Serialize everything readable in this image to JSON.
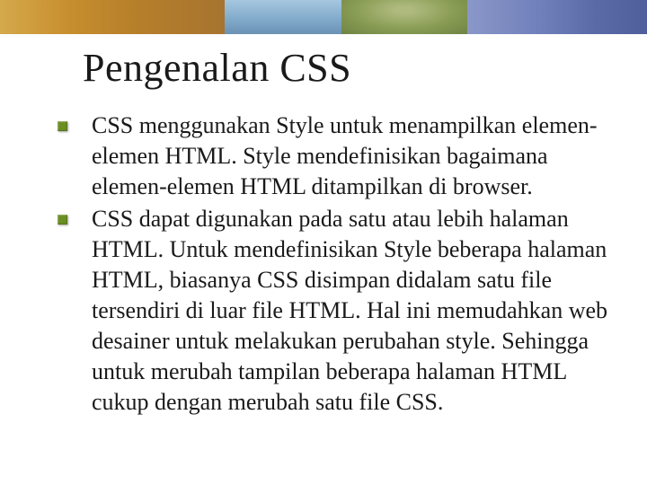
{
  "slide": {
    "title": "Pengenalan CSS",
    "bullets": [
      "CSS menggunakan Style untuk menampilkan elemen-elemen HTML. Style mendefinisikan bagaimana elemen-elemen HTML ditampilkan di browser.",
      "CSS dapat digunakan pada satu atau lebih halaman HTML. Untuk mendefinisikan Style beberapa halaman HTML, biasanya CSS disimpan didalam satu file tersendiri di luar file HTML.  Hal ini memudahkan web desainer untuk melakukan perubahan style. Sehingga untuk merubah tampilan beberapa halaman HTML cukup dengan merubah satu file CSS."
    ]
  }
}
